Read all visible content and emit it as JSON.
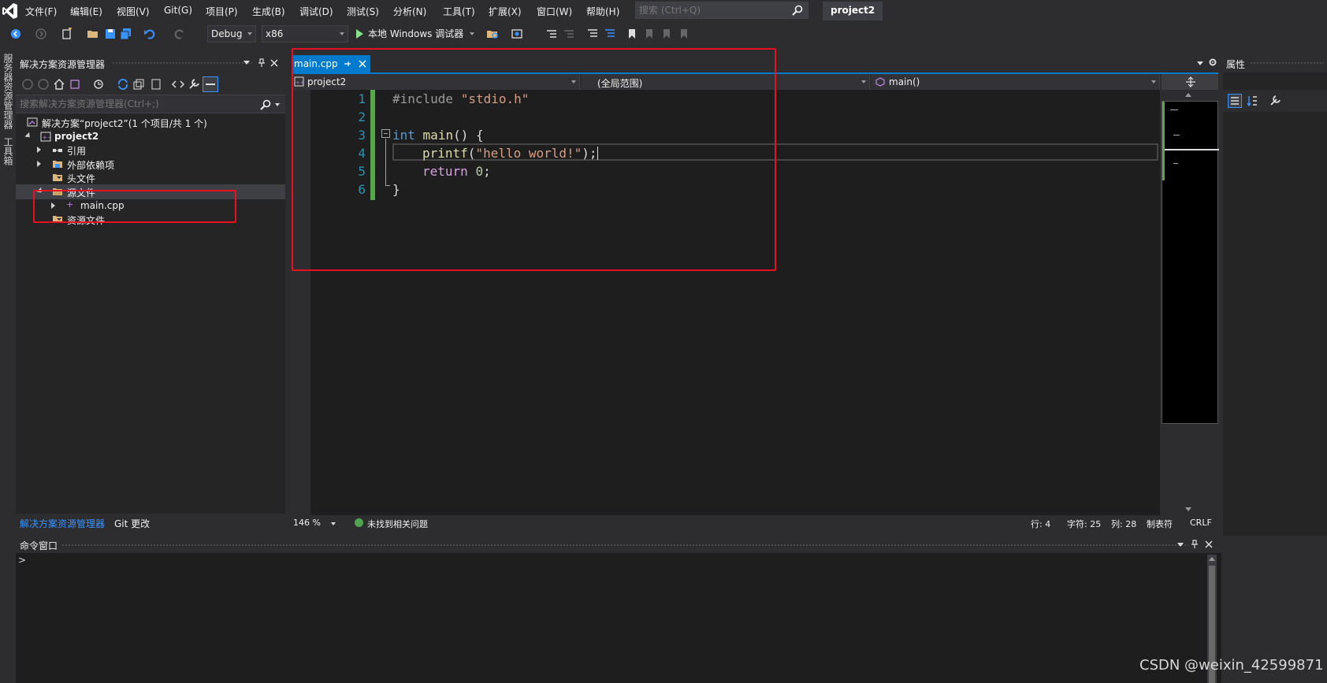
{
  "menubar": {
    "items": [
      "文件(F)",
      "编辑(E)",
      "视图(V)",
      "Git(G)",
      "项目(P)",
      "生成(B)",
      "调试(D)",
      "测试(S)",
      "分析(N)",
      "工具(T)",
      "扩展(X)",
      "窗口(W)",
      "帮助(H)"
    ],
    "search_placeholder": "搜索 (Ctrl+Q)",
    "project_title": "project2"
  },
  "toolbar": {
    "config": "Debug",
    "platform": "x86",
    "run_label": "本地 Windows 调试器"
  },
  "left_strip": {
    "tab1": "服务器资源管理器",
    "tab2": "工具箱"
  },
  "solution_explorer": {
    "title": "解决方案资源管理器",
    "search_placeholder": "搜索解决方案资源管理器(Ctrl+;)",
    "tree": {
      "solution": "解决方案“project2”(1 个项目/共 1 个)",
      "project": "project2",
      "references": "引用",
      "external_deps": "外部依赖项",
      "headers": "头文件",
      "sources": "源文件",
      "main_cpp": "main.cpp",
      "resources": "资源文件"
    },
    "bottom_tabs": [
      "解决方案资源管理器",
      "Git 更改"
    ]
  },
  "editor": {
    "tab_label": "main.cpp",
    "nav": {
      "project": "project2",
      "scope": "(全局范围)",
      "member": "main()"
    },
    "line_numbers": [
      "1",
      "2",
      "3",
      "4",
      "5",
      "6"
    ],
    "code": {
      "l1_pp": "#include ",
      "l1_str": "\"stdio.h\"",
      "l3_kw": "int",
      "l3_fn": "main",
      "l3_rest": "() {",
      "l4_fn": "printf",
      "l4_open": "(",
      "l4_str": "\"hello world!\"",
      "l4_close": ");",
      "l5_kw": "return",
      "l5_num": "0",
      "l5_semi": ";",
      "l6": "}"
    },
    "status": {
      "zoom": "146 %",
      "issues": "未找到相关问题",
      "line": "行: 4",
      "char": "字符: 25",
      "col": "列: 28",
      "tabs": "制表符",
      "eol": "CRLF"
    }
  },
  "properties": {
    "title": "属性"
  },
  "command_window": {
    "title": "命令窗口",
    "prompt": ">"
  },
  "watermark": "CSDN @weixin_42599871",
  "colors": {
    "accent": "#007acc",
    "annotation": "#e81123",
    "change_bar": "#57a64a"
  }
}
